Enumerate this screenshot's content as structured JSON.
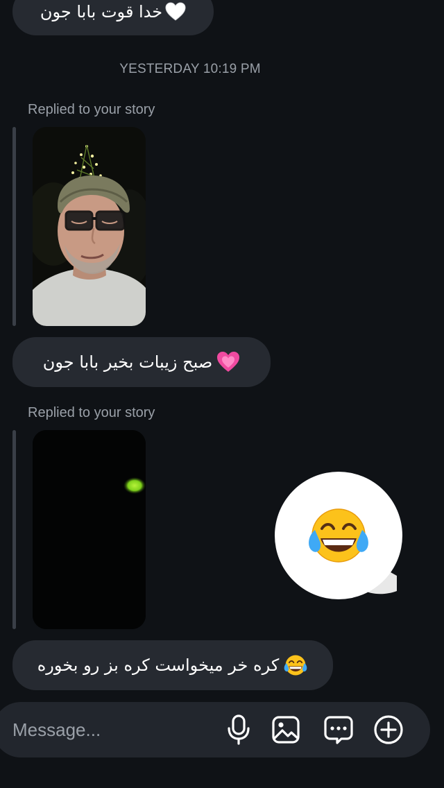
{
  "messages": [
    {
      "text": "خدا قوت بابا جون",
      "emoji": "white-heart"
    },
    {
      "text": "صبح زیبات بخیر بابا جون",
      "emoji": "growing-pink-heart"
    },
    {
      "text": "کره خر میخواست کره بز رو بخوره",
      "emoji": "laughing-tears"
    }
  ],
  "timestamp": "YESTERDAY 10:19 PM",
  "story_replies": [
    {
      "label": "Replied to your story",
      "thumbnail": "man-with-beanie-and-glasses"
    },
    {
      "label": "Replied to your story",
      "thumbnail": "dark-night-with-green-light"
    }
  ],
  "reaction": {
    "emoji": "face-with-tears-of-joy"
  },
  "composer": {
    "placeholder": "Message...",
    "icons": [
      "microphone-icon",
      "image-icon",
      "sticker-chat-icon",
      "plus-circle-icon"
    ]
  },
  "colors": {
    "background": "#0f1216",
    "bubble": "#262a31",
    "muted_text": "#9aa0a8",
    "composer": "#22262d"
  }
}
